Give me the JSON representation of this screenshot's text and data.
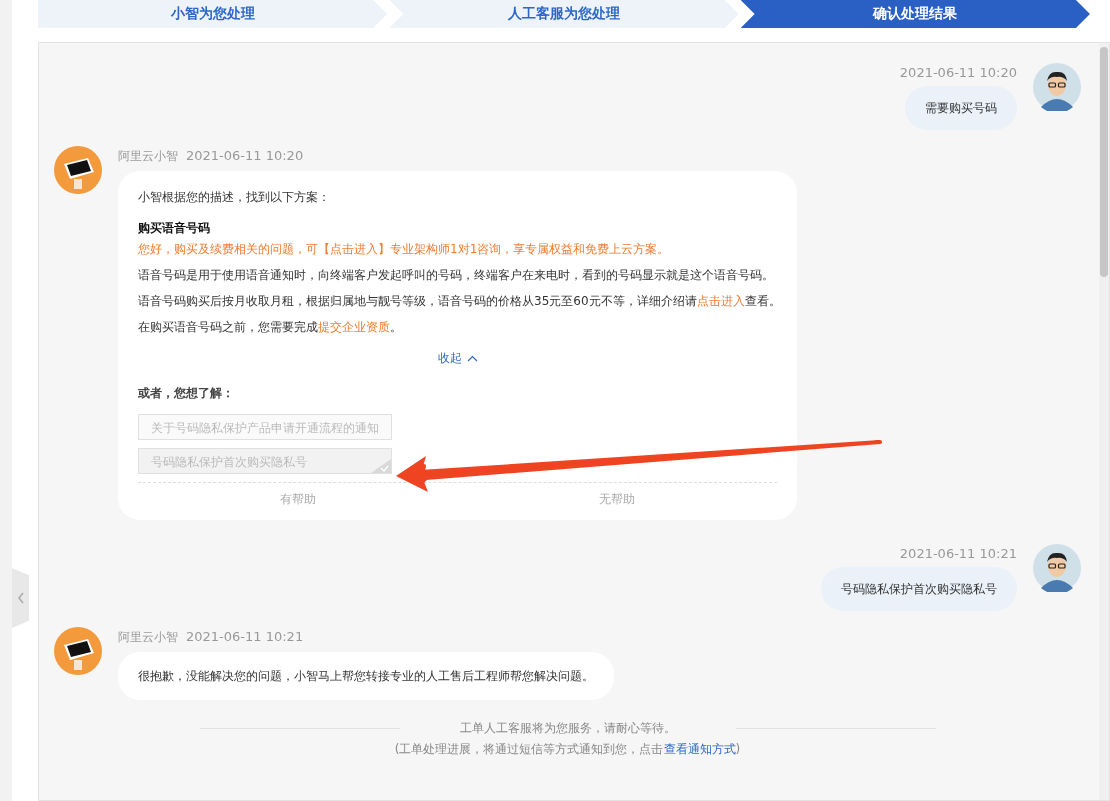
{
  "steps": [
    {
      "label": "小智为您处理",
      "selected": false
    },
    {
      "label": "人工客服为您处理",
      "selected": false
    },
    {
      "label": "确认处理结果",
      "selected": true
    }
  ],
  "messages": [
    {
      "kind": "user",
      "time": "2021-06-11 10:20",
      "text": "需要购买号码"
    },
    {
      "kind": "bot_card",
      "sender": "阿里云小智",
      "time": "2021-06-11 10:20",
      "intro": "小智根据您的描述，找到以下方案：",
      "title": "购买语音号码",
      "notice": "您好，购买及续费相关的问题，可【点击进入】专业架构师1对1咨询，享专属权益和免费上云方案。",
      "paragraphs": [
        [
          {
            "text": "语音号码是用于使用语音通知时，向终端客户发起呼叫的号码，终端客户在来电时，看到的号码显示就是这个语音号码。",
            "link": false
          }
        ],
        [
          {
            "text": "语音号码购买后按月收取月租，根据归属地与靓号等级，语音号码的价格从35元至60元不等，详细介绍请",
            "link": false
          },
          {
            "text": "点击进入",
            "link": true
          },
          {
            "text": "查看。",
            "link": false
          }
        ],
        [
          {
            "text": "在购买语音号码之前，您需要完成",
            "link": false
          },
          {
            "text": "提交企业资质",
            "link": true
          },
          {
            "text": "。",
            "link": false
          }
        ]
      ],
      "collapse": "收起",
      "alt_title": "或者，您想了解：",
      "suggestions": [
        {
          "text": "关于号码隐私保护产品申请开通流程的通知",
          "selected": false
        },
        {
          "text": "号码隐私保护首次购买隐私号",
          "selected": true
        }
      ],
      "feedback": [
        "有帮助",
        "无帮助"
      ]
    },
    {
      "kind": "user",
      "time": "2021-06-11 10:21",
      "text": "号码隐私保护首次购买隐私号"
    },
    {
      "kind": "bot",
      "sender": "阿里云小智",
      "time": "2021-06-11 10:21",
      "text": "很抱歉，没能解决您的问题，小智马上帮您转接专业的人工售后工程师帮您解决问题。"
    },
    {
      "kind": "system",
      "text": "工单人工客服将为您服务，请耐心等待。",
      "note": [
        {
          "text": "(工单处理进展，将通过短信等方式通知到您，点击",
          "link": false
        },
        {
          "text": "查看通知方式",
          "link": true
        },
        {
          "text": ")",
          "link": false
        }
      ]
    }
  ]
}
